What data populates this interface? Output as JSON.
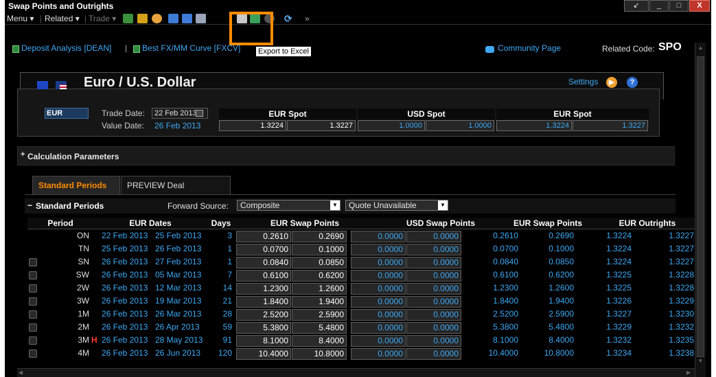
{
  "window": {
    "title": "Swap Points and Outrights",
    "controls": [
      "↙",
      "_",
      "□",
      "X"
    ]
  },
  "menubar": {
    "menu": "Menu ▾",
    "related": "Related ▾",
    "trade": "Trade ▾",
    "more": "»"
  },
  "tooltip": "Export to Excel",
  "links": {
    "deposit": "Deposit Analysis [DEAN]",
    "separator": "|",
    "bestfx": "Best FX/MM Curve [FXCV]",
    "community": "Community Page",
    "related_code_label": "Related Code:",
    "related_code": "SPO"
  },
  "header": {
    "pair": "Euro / U.S. Dollar",
    "settings": "Settings",
    "settings_icon_glyph": "▶",
    "help_icon_glyph": "?",
    "ccy": "EUR",
    "trade_date_label": "Trade Date:",
    "trade_date": "22 Feb 2013",
    "value_date_label": "Value Date:",
    "value_date": "26 Feb 2013",
    "spots": [
      {
        "title": "EUR Spot",
        "bid": "1.3224",
        "ask": "1.3227"
      },
      {
        "title": "USD Spot",
        "bid": "1.0000",
        "ask": "1.0000"
      },
      {
        "title": "EUR Spot",
        "bid": "1.3224",
        "ask": "1.3227"
      }
    ]
  },
  "calc_params": {
    "toggle": "+",
    "label": "Calculation Parameters"
  },
  "tabs": {
    "standard": "Standard Periods",
    "preview": "PREVIEW Deal Calculation"
  },
  "std_bar": {
    "toggle": "−",
    "label": "Standard Periods",
    "forward_source_label": "Forward Source:",
    "forward_source": "Composite",
    "quote": "Quote Unavailable"
  },
  "table": {
    "headers": [
      "Period",
      "EUR Dates",
      "Days",
      "EUR Swap Points",
      "USD Swap Points",
      "EUR Swap Points",
      "EUR Outrights"
    ],
    "rows": [
      {
        "period": "ON",
        "flag": "",
        "d1": "22 Feb 2013",
        "d2": "25 Feb 2013",
        "days": "3",
        "esb": "0.2610",
        "esa": "0.2690",
        "usb": "0.0000",
        "usa": "0.0000",
        "e2b": "0.2610",
        "e2a": "0.2690",
        "ob": "1.3224",
        "oa": "1.3227",
        "chk": false
      },
      {
        "period": "TN",
        "flag": "",
        "d1": "25 Feb 2013",
        "d2": "26 Feb 2013",
        "days": "1",
        "esb": "0.0700",
        "esa": "0.1000",
        "usb": "0.0000",
        "usa": "0.0000",
        "e2b": "0.0700",
        "e2a": "0.1000",
        "ob": "1.3224",
        "oa": "1.3227",
        "chk": false
      },
      {
        "period": "SN",
        "flag": "",
        "d1": "26 Feb 2013",
        "d2": "27 Feb 2013",
        "days": "1",
        "esb": "0.0840",
        "esa": "0.0850",
        "usb": "0.0000",
        "usa": "0.0000",
        "e2b": "0.0840",
        "e2a": "0.0850",
        "ob": "1.3224",
        "oa": "1.3227",
        "chk": true
      },
      {
        "period": "SW",
        "flag": "",
        "d1": "26 Feb 2013",
        "d2": "05 Mar 2013",
        "days": "7",
        "esb": "0.6100",
        "esa": "0.6200",
        "usb": "0.0000",
        "usa": "0.0000",
        "e2b": "0.6100",
        "e2a": "0.6200",
        "ob": "1.3225",
        "oa": "1.3228",
        "chk": true
      },
      {
        "period": "2W",
        "flag": "",
        "d1": "26 Feb 2013",
        "d2": "12 Mar 2013",
        "days": "14",
        "esb": "1.2300",
        "esa": "1.2600",
        "usb": "0.0000",
        "usa": "0.0000",
        "e2b": "1.2300",
        "e2a": "1.2600",
        "ob": "1.3225",
        "oa": "1.3228",
        "chk": true
      },
      {
        "period": "3W",
        "flag": "",
        "d1": "26 Feb 2013",
        "d2": "19 Mar 2013",
        "days": "21",
        "esb": "1.8400",
        "esa": "1.9400",
        "usb": "0.0000",
        "usa": "0.0000",
        "e2b": "1.8400",
        "e2a": "1.9400",
        "ob": "1.3226",
        "oa": "1.3229",
        "chk": true
      },
      {
        "period": "1M",
        "flag": "",
        "d1": "26 Feb 2013",
        "d2": "26 Mar 2013",
        "days": "28",
        "esb": "2.5200",
        "esa": "2.5900",
        "usb": "0.0000",
        "usa": "0.0000",
        "e2b": "2.5200",
        "e2a": "2.5900",
        "ob": "1.3227",
        "oa": "1.3230",
        "chk": true
      },
      {
        "period": "2M",
        "flag": "",
        "d1": "26 Feb 2013",
        "d2": "26 Apr 2013",
        "days": "59",
        "esb": "5.3800",
        "esa": "5.4800",
        "usb": "0.0000",
        "usa": "0.0000",
        "e2b": "5.3800",
        "e2a": "5.4800",
        "ob": "1.3229",
        "oa": "1.3232",
        "chk": true
      },
      {
        "period": "3M",
        "flag": "H",
        "d1": "26 Feb 2013",
        "d2": "28 May 2013",
        "days": "91",
        "esb": "8.1000",
        "esa": "8.4000",
        "usb": "0.0000",
        "usa": "0.0000",
        "e2b": "8.1000",
        "e2a": "8.4000",
        "ob": "1.3232",
        "oa": "1.3235",
        "chk": true
      },
      {
        "period": "4M",
        "flag": "",
        "d1": "26 Feb 2013",
        "d2": "26 Jun 2013",
        "days": "120",
        "esb": "10.4000",
        "esa": "10.8000",
        "usb": "0.0000",
        "usa": "0.0000",
        "e2b": "10.4000",
        "e2a": "10.8000",
        "ob": "1.3234",
        "oa": "1.3238",
        "chk": true
      }
    ]
  },
  "colors": {
    "accent": "#ff8c00",
    "link": "#3fa9f5",
    "holiday": "#ff3b30"
  }
}
